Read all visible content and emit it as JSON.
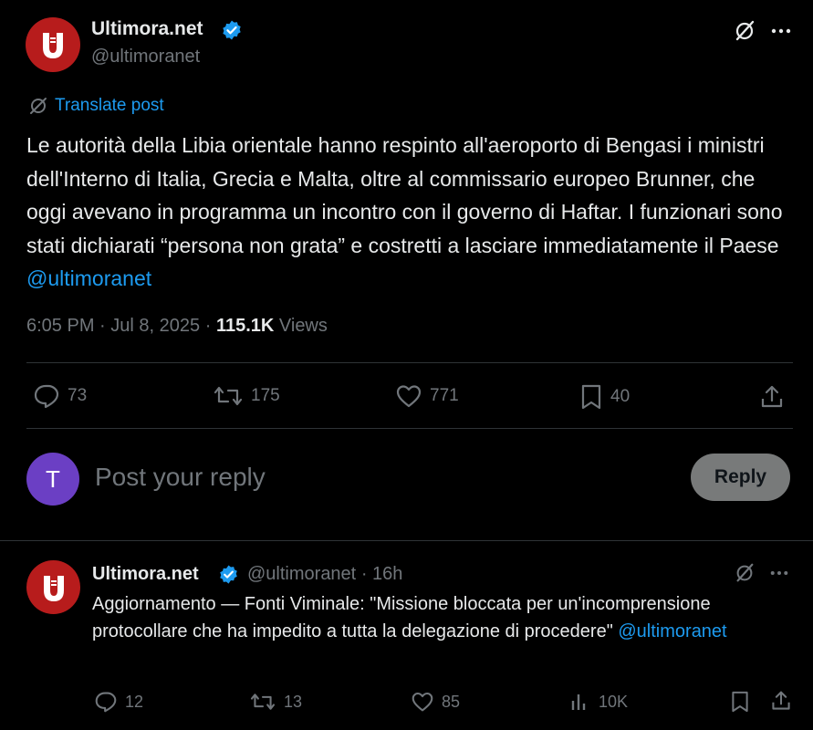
{
  "post": {
    "author_name": "Ultimora.net",
    "author_handle": "@ultimoranet",
    "translate_label": "Translate post",
    "body_text": "Le autorità della Libia orientale hanno respinto all'aeroporto di Bengasi i ministri dell'Interno di Italia, Grecia e Malta, oltre al commissario europeo Brunner, che oggi avevano in programma un incontro con il governo di Haftar. I funzionari sono stati dichiarati “persona non grata” e costretti a lasciare immediatamente il Paese",
    "body_mention": "@ultimoranet",
    "time": "6:05 PM",
    "date": "Jul 8, 2025",
    "views_count": "115.1K",
    "views_label": "Views",
    "replies": "73",
    "reposts": "175",
    "likes": "771",
    "bookmarks": "40"
  },
  "composer": {
    "avatar_letter": "T",
    "placeholder": "Post your reply",
    "reply_label": "Reply"
  },
  "reply": {
    "author_name": "Ultimora.net",
    "author_handle": "@ultimoranet",
    "dot": "·",
    "age": "16h",
    "body_text": "Aggiornamento — Fonti Viminale: \"Missione bloccata per un'incomprensione protocollare che ha impedito a tutta la delegazione di procedere\"",
    "body_mention": "@ultimoranet",
    "replies": "12",
    "reposts": "13",
    "likes": "85",
    "views": "10K"
  },
  "colors": {
    "background": "#000000",
    "accent": "#1d9bf0",
    "muted": "#71767b",
    "avatar_brand": "#b71c1c",
    "user_avatar": "#6b3fc4"
  },
  "icons": [
    "verified-badge-icon",
    "grok-icon",
    "more-icon",
    "translate-icon",
    "reply-icon",
    "repost-icon",
    "like-icon",
    "bookmark-icon",
    "share-icon",
    "views-icon"
  ]
}
